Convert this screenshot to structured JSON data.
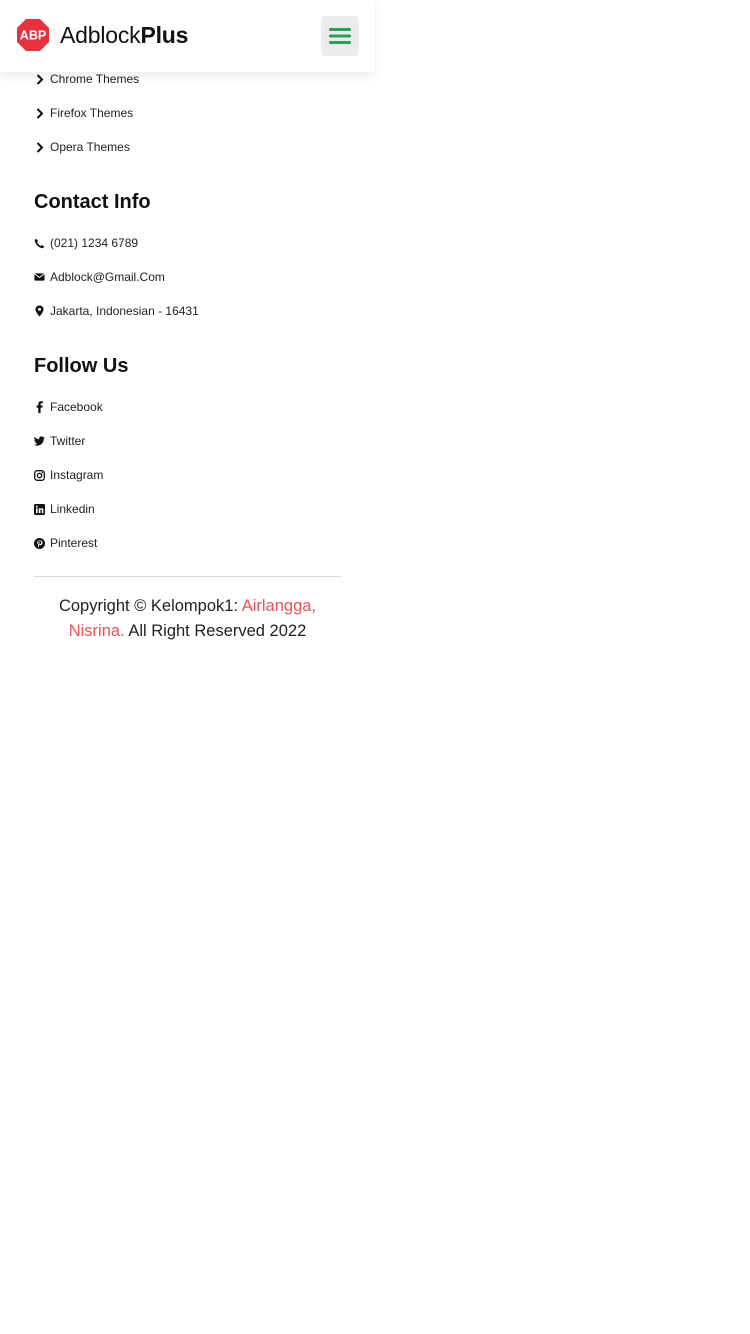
{
  "header": {
    "logo_regular": "Adblock",
    "logo_bold": "Plus",
    "logo_badge": "ABP",
    "menu_icon": "hamburger-menu-icon"
  },
  "themes": {
    "items": [
      {
        "label": "Chrome Themes",
        "icon": "chevron-right-icon"
      },
      {
        "label": "Firefox Themes",
        "icon": "chevron-right-icon"
      },
      {
        "label": "Opera Themes",
        "icon": "chevron-right-icon"
      }
    ]
  },
  "contact": {
    "title": "Contact Info",
    "phone": "(021) 1234 6789",
    "email": "Adblock@Gmail.Com",
    "address": "Jakarta, Indonesian - 16431"
  },
  "follow": {
    "title": "Follow Us",
    "items": [
      {
        "label": "Facebook",
        "icon": "facebook-icon"
      },
      {
        "label": "Twitter",
        "icon": "twitter-icon"
      },
      {
        "label": "Instagram",
        "icon": "instagram-icon"
      },
      {
        "label": "Linkedin",
        "icon": "linkedin-icon"
      },
      {
        "label": "Pinterest",
        "icon": "pinterest-icon"
      }
    ]
  },
  "copyright": {
    "prefix": "Copyright © Kelompok1: ",
    "names": "Airlangga, Nisrina.",
    "suffix": " All Right Reserved 2022"
  },
  "colors": {
    "accent": "#e8525a",
    "menu_icon": "#2e9e5b",
    "logo_badge": "#e6323e"
  }
}
